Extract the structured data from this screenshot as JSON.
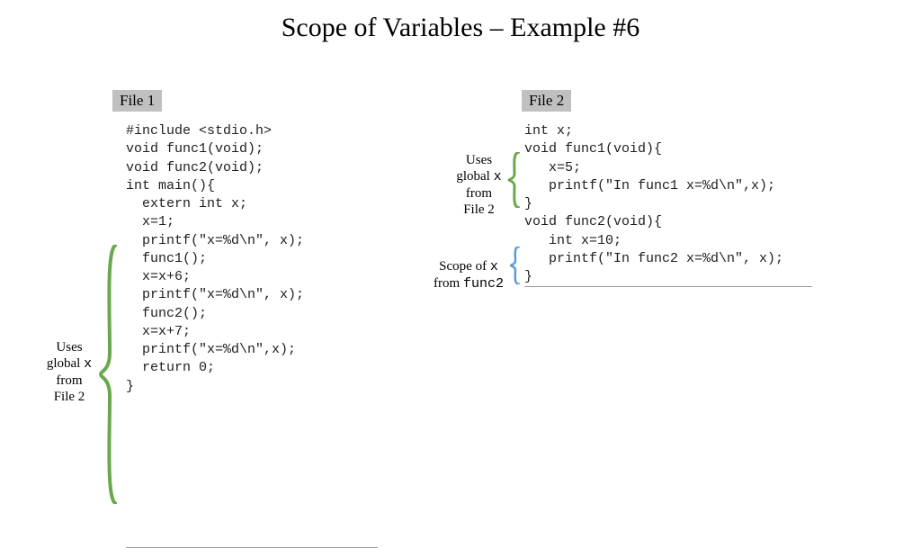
{
  "title": "Scope of Variables – Example #6",
  "file1": {
    "label": "File 1",
    "code": "#include <stdio.h>\nvoid func1(void);\nvoid func2(void);\nint main(){\n  extern int x;\n  x=1;\n  printf(\"x=%d\\n\", x);\n  func1();\n  x=x+6;\n  printf(\"x=%d\\n\", x);\n  func2();\n  x=x+7;\n  printf(\"x=%d\\n\",x);\n  return 0;\n}"
  },
  "file2": {
    "label": "File 2",
    "code": "int x;\nvoid func1(void){\n   x=5;\n   printf(\"In func1 x=%d\\n\",x);\n}\nvoid func2(void){\n   int x=10;\n   printf(\"In func2 x=%d\\n\", x);\n}"
  },
  "annotations": {
    "left": {
      "line1": "Uses",
      "line2_a": "global ",
      "line2_b": "x",
      "line3": "from",
      "line4": "File 2"
    },
    "r1": {
      "line1": "Uses",
      "line2_a": "global ",
      "line2_b": "x",
      "line3": "from",
      "line4": "File 2"
    },
    "r2": {
      "line1_a": "Scope of ",
      "line1_b": "x",
      "line2_a": "from ",
      "line2_b": "func2"
    }
  }
}
